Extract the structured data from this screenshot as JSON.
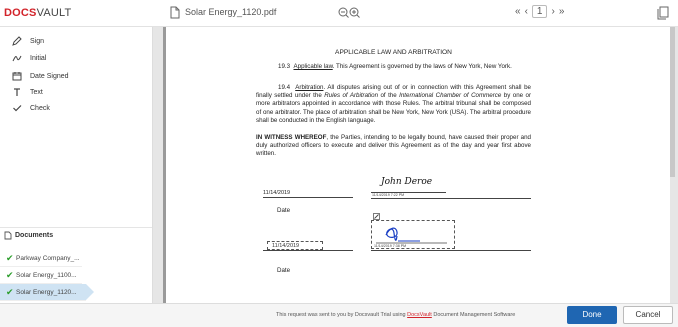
{
  "header": {
    "logo_part1": "DOCS",
    "logo_part2": "VAULT",
    "file_name": "Solar Energy_1120.pdf",
    "pager": {
      "first": "«",
      "prev": "‹",
      "page": "1",
      "next": "›",
      "last": "»"
    }
  },
  "tools": [
    {
      "label": "Sign",
      "icon": "pen-icon"
    },
    {
      "label": "Initial",
      "icon": "initial-icon"
    },
    {
      "label": "Date Signed",
      "icon": "calendar-icon"
    },
    {
      "label": "Text",
      "icon": "text-icon"
    },
    {
      "label": "Check",
      "icon": "check-icon"
    }
  ],
  "documents": {
    "title": "Documents",
    "items": [
      {
        "label": "Parkway Company_...",
        "active": false
      },
      {
        "label": "Solar Energy_1100...",
        "active": false
      },
      {
        "label": "Solar Energy_1120...",
        "active": true
      }
    ]
  },
  "pdf": {
    "heading": "APPLICABLE LAW AND ARBITRATION",
    "p1_num": "19.3",
    "p1_title": "Applicable law",
    "p1_text": ". This Agreement is governed by the laws of New York, New York.",
    "p2_num": "19.4",
    "p2_title": "Arbitration",
    "p2_text_a": ". All disputes arising out of or in connection with this Agreement shall be finally settled under the ",
    "p2_italic_a": "Rules of Arbitration",
    "p2_text_b": " of the ",
    "p2_italic_b": "International Chamber of Commerce",
    "p2_text_c": " by one or more arbitrators appointed in accordance with those Rules. The arbitral tribunal shall be composed of one arbitrator. The place of arbitration shall be New York, New York (USA). The arbitral procedure shall be conducted in the English language.",
    "p3_bold": "IN WITNESS WHEREOF",
    "p3_text": ", the Parties, intending to be legally bound, have caused their proper and duly authorized officers to execute and deliver this Agreement as of the day and year first above written.",
    "date_value_1": "11/14/2019",
    "signature_name": "John Deroe",
    "timestamp_1": "11/14/2019 7:22 PM",
    "date_label_1": "Date",
    "date_value_2": "11/14/2019",
    "timestamp_2": "11/14/2019 7:38 PM",
    "date_label_2": "Date"
  },
  "footer": {
    "msg_a": "This request was sent to you by Docsvault Trial using ",
    "msg_brand": "DocsVault",
    "msg_b": " Document Management Software",
    "done": "Done",
    "cancel": "Cancel"
  },
  "colors": {
    "accent": "#1f66b2",
    "brand": "#d2232a",
    "active_doc": "#cfe3f3",
    "check": "#2a9d2a"
  }
}
